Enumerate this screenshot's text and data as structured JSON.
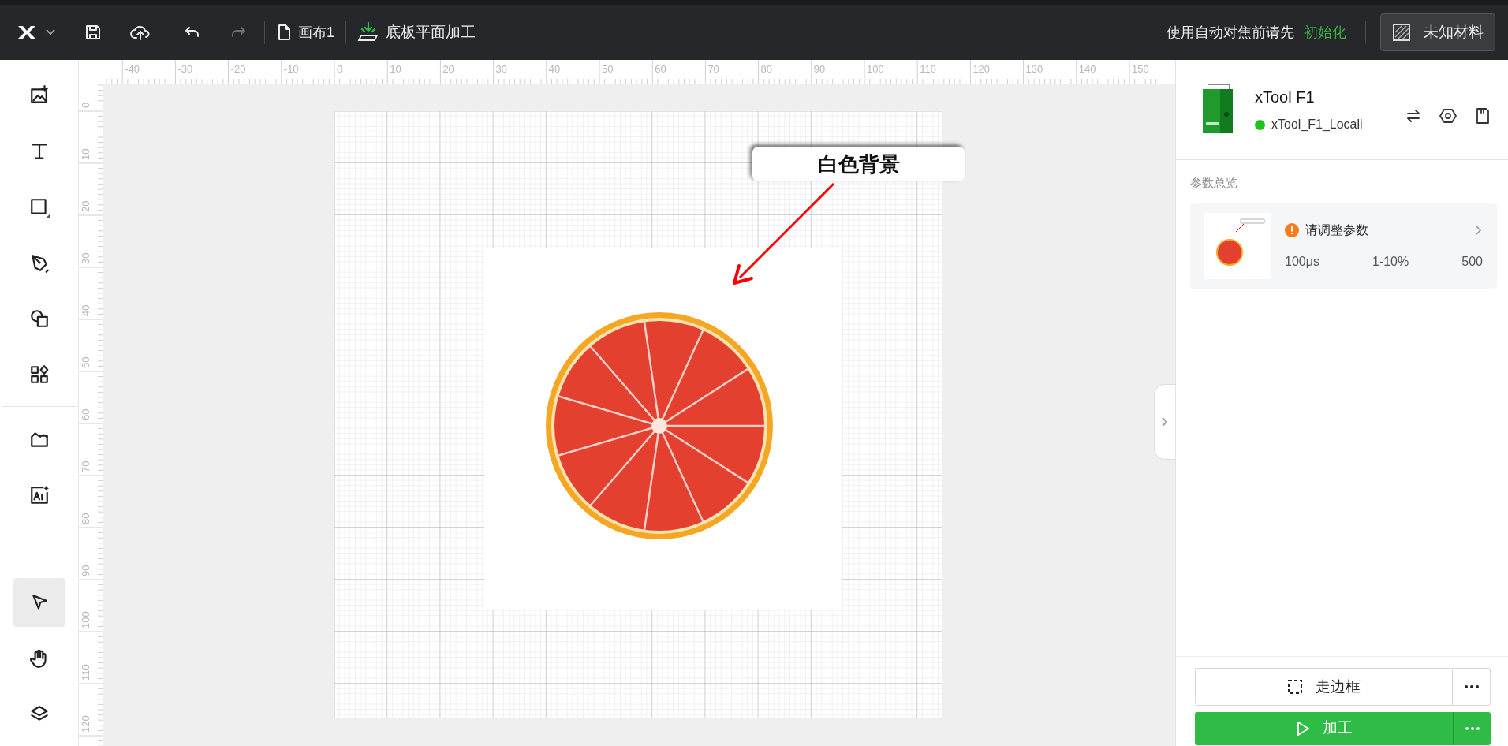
{
  "topbar": {
    "history_buttons": [
      {
        "disabled": false
      },
      {
        "disabled": true
      }
    ],
    "canvas_name": "画布1",
    "process_mode": "底板平面加工",
    "focus_hint": "使用自动对焦前请先",
    "focus_link": "初始化",
    "material": "未知材料"
  },
  "create_tools": [
    {
      "selected": false
    },
    {
      "selected": false
    },
    {
      "selected": false
    },
    {
      "selected": false
    },
    {
      "selected": false
    },
    {
      "selected": false
    }
  ],
  "extra_tools": [
    {
      "selected": false
    },
    {
      "selected": false
    }
  ],
  "view_tools": [
    {
      "selected": true
    },
    {
      "selected": false
    },
    {
      "selected": false
    }
  ],
  "rulers": {
    "top_labels": [
      "-40",
      "-30",
      "-20",
      "-10",
      "0",
      "10",
      "20",
      "30",
      "40",
      "50",
      "60",
      "70",
      "80",
      "90",
      "100",
      "110",
      "120",
      "130",
      "140",
      "150"
    ],
    "left_labels": [
      "0",
      "10",
      "20",
      "30",
      "40",
      "50",
      "60",
      "70",
      "80",
      "90",
      "100",
      "110",
      "120"
    ]
  },
  "canvas": {
    "callout": "白色背景"
  },
  "device": {
    "name": "xTool F1",
    "connection": "xTool_F1_Locali",
    "connected": true
  },
  "params": {
    "title": "参数总览",
    "items": [
      {
        "warning": "请调整参数",
        "values": [
          "100μs",
          "1-10%",
          "500"
        ]
      }
    ]
  },
  "actions": {
    "frame_button": "走边框",
    "process_button": "加工"
  }
}
